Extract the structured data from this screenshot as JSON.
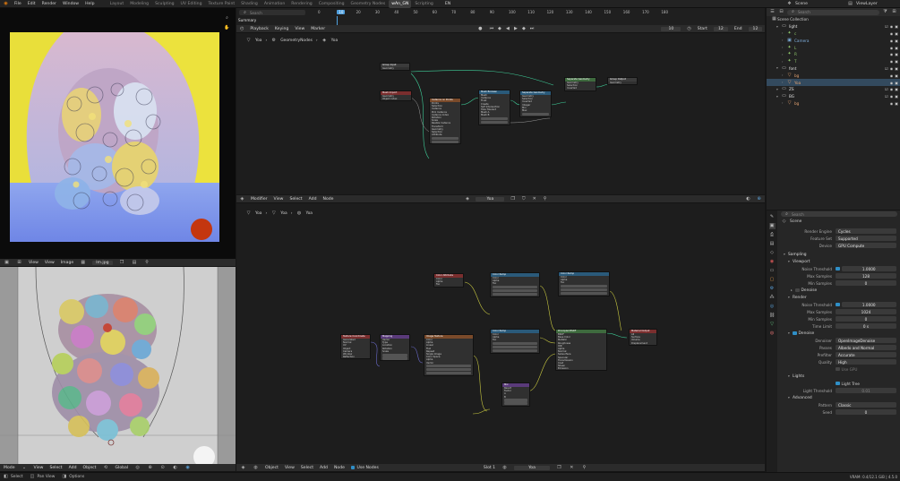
{
  "topbar": {
    "menus": [
      "File",
      "Edit",
      "Render",
      "Window",
      "Help"
    ],
    "workspaces": [
      "Layout",
      "Modeling",
      "Sculpting",
      "UV Editing",
      "Texture Paint",
      "Shading",
      "Animation",
      "Rendering",
      "Compositing",
      "Geometry Nodes",
      "wAn_GN",
      "Scripting"
    ],
    "active_workspace": "wAn_GN",
    "lang": "EN",
    "scene": "Scene",
    "view_layer": "ViewLayer"
  },
  "timeline": {
    "search_placeholder": "Search",
    "summary": "Summary",
    "ticks": [
      "0",
      "10",
      "20",
      "30",
      "40",
      "50",
      "60",
      "70",
      "80",
      "90",
      "100",
      "110",
      "120",
      "130",
      "140",
      "150",
      "160",
      "170",
      "180"
    ],
    "current_frame": "10",
    "menus": [
      "Playback",
      "Keying",
      "View",
      "Marker"
    ],
    "frame_field": "10",
    "start_label": "Start",
    "start_value": "12",
    "end_label": "End",
    "end_value": "12"
  },
  "geo_editor": {
    "breadcrumb": [
      "Yoa",
      "GeometryNodes",
      "Yoa"
    ],
    "nodes": [
      {
        "title": "Group Input",
        "color": "#3b3b3b",
        "rows": [
          "Geometry"
        ]
      },
      {
        "title": "Mesh Import",
        "color": "#7a2e2e",
        "rows": [
          "Geometry",
          "Object Index"
        ]
      },
      {
        "title": "Instance on Points",
        "color": "#7a4a2a",
        "rows": [
          "Points",
          "Selection",
          "Instance",
          "Pick Instance",
          "Instance Index",
          "Rotation",
          "Scale",
          "Realize Instance",
          "Transform",
          "Geometry",
          "Selection",
          "Attribute"
        ]
      },
      {
        "title": "Mesh Boolean",
        "color": "#2a5a7a",
        "rows": [
          "Mesh",
          "Instance",
          "Float",
          "Create",
          "Self Intersection",
          "Hole Tolerant",
          "Mesh A",
          "Mesh B"
        ]
      },
      {
        "title": "Separate Geometry",
        "color": "#2a5a7a",
        "rows": [
          "Geometry",
          "Selection",
          "Inverted",
          "Integer",
          "Min",
          "Max"
        ]
      },
      {
        "title": "Separate Geometry",
        "color": "#3e6a3e",
        "rows": [
          "Geometry",
          "Selection",
          "Inverted"
        ]
      },
      {
        "title": "Group Output",
        "color": "#3b3b3b",
        "rows": [
          "Geometry"
        ]
      }
    ]
  },
  "shader_editor": {
    "header": {
      "editor": "Modifier",
      "menus": [
        "View",
        "Select",
        "Add",
        "Node"
      ],
      "object": "Yoa"
    },
    "breadcrumb": [
      "Yoa",
      "Yoa",
      "Yoa"
    ],
    "nodes": [
      {
        "title": "Color Attribute",
        "color": "#7a2e2e",
        "rows": [
          "Color",
          "Alpha",
          "Fac"
        ]
      },
      {
        "title": "Texture Coordinate",
        "color": "#7a2e2e",
        "rows": [
          "Generated",
          "Normal",
          "UV",
          "Object",
          "Camera",
          "Window",
          "Reflection"
        ]
      },
      {
        "title": "Mapping",
        "color": "#5a3a7a",
        "rows": [
          "Vector",
          "Type",
          "Location",
          "Rotation",
          "Scale"
        ]
      },
      {
        "title": "Image Texture",
        "color": "#7a4a2a",
        "rows": [
          "Color",
          "Alpha",
          "Linear",
          "Flat",
          "Repeat",
          "Single Image",
          "Color Space",
          "Alpha",
          "Vector"
        ]
      },
      {
        "title": "Color Ramp",
        "color": "#2a5a7a",
        "rows": [
          "Color",
          "Alpha",
          "Fac"
        ]
      },
      {
        "title": "Color Ramp",
        "color": "#2a5a7a",
        "rows": [
          "Color",
          "Alpha",
          "Fac"
        ]
      },
      {
        "title": "Color Ramp",
        "color": "#2a5a7a",
        "rows": [
          "Color",
          "Alpha",
          "Fac"
        ]
      },
      {
        "title": "Mix",
        "color": "#5a3a7a",
        "rows": [
          "Result",
          "Factor",
          "A",
          "B"
        ]
      },
      {
        "title": "Principled BSDF",
        "color": "#3e6a3e",
        "rows": [
          "BSDF",
          "Base Color",
          "Metallic",
          "Roughness",
          "IOR",
          "Alpha",
          "Normal",
          "Subsurface",
          "Specular",
          "Transmission",
          "Coat",
          "Sheen",
          "Emission"
        ]
      },
      {
        "title": "Material Output",
        "color": "#7a2e2e",
        "rows": [
          "All",
          "Surface",
          "Volume",
          "Displacement"
        ]
      }
    ],
    "footer": {
      "menus": [
        "Object",
        "View",
        "Select",
        "Add",
        "Node"
      ],
      "use_nodes": "Use Nodes",
      "slot": "Slot 1",
      "material": "Yoa"
    }
  },
  "image_editor": {
    "menus": [
      "View",
      "View",
      "Image"
    ],
    "image_name": "lm.jpg"
  },
  "viewport3d": {
    "menus": [
      "Object",
      "View",
      "Select",
      "Add",
      "Object"
    ],
    "orientation": "Global",
    "mode": "Mode"
  },
  "outliner": {
    "search_placeholder": "Search",
    "root": "Scene Collection",
    "rows": [
      {
        "depth": 1,
        "name": "light",
        "color": "#e0e0e0",
        "type": "collection"
      },
      {
        "depth": 2,
        "name": "c",
        "color": "#8ec66a",
        "type": "light"
      },
      {
        "depth": 2,
        "name": "Camera",
        "color": "#7fb0e0",
        "type": "camera"
      },
      {
        "depth": 2,
        "name": "L",
        "color": "#8ec66a",
        "type": "light"
      },
      {
        "depth": 2,
        "name": "R",
        "color": "#8ec66a",
        "type": "light"
      },
      {
        "depth": 2,
        "name": "T",
        "color": "#8ec66a",
        "type": "light"
      },
      {
        "depth": 1,
        "name": "font",
        "color": "#e0e0e0",
        "type": "collection"
      },
      {
        "depth": 2,
        "name": "bg",
        "color": "#e0a070",
        "type": "mesh"
      },
      {
        "depth": 2,
        "name": "Yoa",
        "color": "#e0a070",
        "type": "mesh"
      },
      {
        "depth": 1,
        "name": "ZS",
        "color": "#e0e0e0",
        "type": "collection"
      },
      {
        "depth": 1,
        "name": "BG",
        "color": "#e0e0e0",
        "type": "collection"
      },
      {
        "depth": 2,
        "name": "bg",
        "color": "#e0a070",
        "type": "mesh"
      }
    ]
  },
  "properties": {
    "search_placeholder": "Search",
    "scene": "Scene",
    "render_engine_label": "Render Engine",
    "render_engine": "Cycles",
    "feature_set_label": "Feature Set",
    "feature_set": "Supported",
    "device_label": "Device",
    "device": "GPU Compute",
    "sampling": "Sampling",
    "viewport": "Viewport",
    "noise_threshold_label": "Noise Threshold",
    "vp_noise_threshold": "1.0000",
    "max_samples_label": "Max Samples",
    "vp_max_samples": "128",
    "min_samples_label": "Min Samples",
    "vp_min_samples": "0",
    "denoise": "Denoise",
    "render": "Render",
    "r_noise_threshold": "1.0000",
    "r_max_samples": "1024",
    "r_min_samples": "0",
    "time_limit_label": "Time Limit",
    "r_time_limit": "0 s",
    "denoise_section": "Denoise",
    "denoiser_label": "Denoiser",
    "denoiser": "OpenImageDenoise",
    "passes_label": "Passes",
    "passes": "Albedo and Normal",
    "prefilter_label": "Prefilter",
    "prefilter": "Accurate",
    "quality_label": "Quality",
    "quality": "High",
    "use_gpu": "Use GPU",
    "lights": "Lights",
    "light_tree": "Light Tree",
    "light_threshold_label": "Light Threshold",
    "light_threshold": "0.01",
    "advanced": "Advanced",
    "pattern_label": "Pattern",
    "pattern": "Classic",
    "seed_label": "Seed",
    "seed": "0"
  },
  "statusbar": {
    "select": "Select",
    "pan_view": "Pan View",
    "options": "Options",
    "right": "VRAM: 0.4/12.1 GiB | 4.5.0"
  },
  "colors": {
    "accent": "#3d8fd1",
    "frame_cursor": "#4f9fde",
    "active_tab": "#3d3d3d"
  }
}
